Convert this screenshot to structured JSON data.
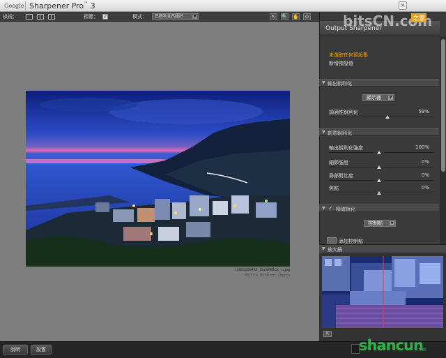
{
  "titlebar": {
    "brand": "Google",
    "app_name": "Sharpener Pro",
    "version": "3",
    "trademark": "™",
    "close": "×"
  },
  "toolbar": {
    "view_label": "檢視：",
    "preview_label": "預覽：",
    "preview_checked": "✓",
    "mode_label": "模式：",
    "mode_value": "已銳利化的圖片",
    "tools": [
      "↖",
      "🔍",
      "✋",
      "⊙"
    ]
  },
  "image": {
    "filename": "11801206455_f1a3d90b2c_o.jpg",
    "size_info": "65.53 x 70.56 cm, 28ppm"
  },
  "panel": {
    "header": "Output Sharpener",
    "preset_title": "未選取任何預設集",
    "preset_sub": "新增預設值",
    "sections": {
      "output": "輸出銳利化",
      "creative": "創意銳利化",
      "selective": "精確銳化",
      "loupe": "放大鏡"
    },
    "output_device": "顯示器",
    "adaptive_label": "調適性銳利化",
    "adaptive_value": "59%",
    "controls": [
      {
        "label": "輸出銳利化強度",
        "value": "100%"
      },
      {
        "label": "細節強度",
        "value": "0%"
      },
      {
        "label": "局部對比度",
        "value": "0%"
      },
      {
        "label": "焦點",
        "value": "0%"
      }
    ],
    "control_points_select": "控制點",
    "add_control_point": "添加控制點"
  },
  "bottombar": {
    "help": "說明",
    "settings": "設置"
  },
  "watermarks": {
    "top": "bitsCN.com",
    "top_badge": "之家",
    "top_url": "bitsCN.com",
    "bottom": "shancun",
    "bottom_url": ".net"
  },
  "colors": {
    "accent": "#f0a000",
    "panel_bg": "#3a3a3a",
    "canvas_bg": "#7e7e7e"
  }
}
